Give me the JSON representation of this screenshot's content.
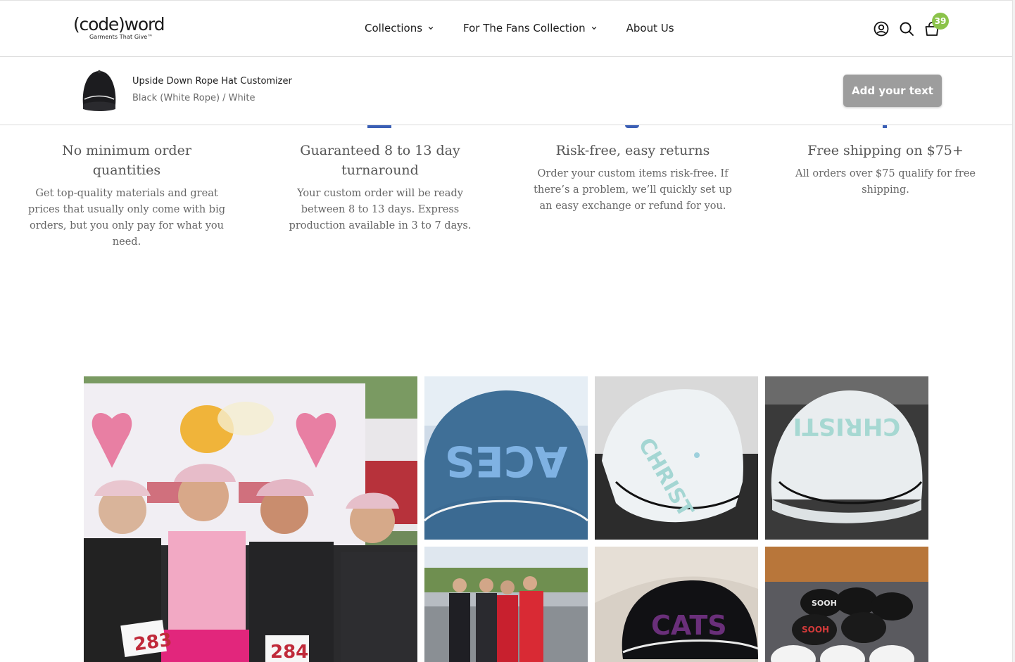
{
  "header": {
    "logo": {
      "main": "(code)word",
      "tagline": "Garments That Give™"
    },
    "nav": [
      {
        "label": "Collections",
        "has_dropdown": true
      },
      {
        "label": "For The Fans Collection",
        "has_dropdown": true
      },
      {
        "label": "About Us",
        "has_dropdown": false
      }
    ],
    "icons": [
      "account-icon",
      "search-icon",
      "cart-icon"
    ],
    "cart_count": "39",
    "badge_color": "#8bc34a"
  },
  "product_bar": {
    "title": "Upside Down Rope Hat Customizer",
    "variant": "Black (White Rope) / White",
    "cta_label": "Add your text",
    "cta_color": "#9d9d9d"
  },
  "features": [
    {
      "title": "No minimum order quantities",
      "body": "Get top-quality materials and great prices that usually only come with big orders, but you only pay for what you need."
    },
    {
      "title": "Guaranteed 8 to 13 day turnaround",
      "body": "Your custom order will be ready between 8 to 13 days. Express production available in 3 to 7 days."
    },
    {
      "title": "Risk-free, easy returns",
      "body": "Order your custom items risk-free. If there’s a problem, we’ll quickly set up an easy exchange or refund for you."
    },
    {
      "title": "Free shipping on $75+",
      "body": "All orders over $75 qualify for free shipping."
    }
  ],
  "gallery": {
    "tiles": [
      {
        "desc": "team-photo-pink-hats",
        "text": "283"
      },
      {
        "desc": "aces-hat-back",
        "text": "ACES"
      },
      {
        "desc": "white-hat-christ-left",
        "text": "CHRIST"
      },
      {
        "desc": "white-hat-christ-right",
        "text": "CHRISTI"
      },
      {
        "desc": "group-photo-outdoors",
        "text": ""
      },
      {
        "desc": "black-hat-cats",
        "text": "CATS"
      },
      {
        "desc": "hats-on-floor",
        "text": "SOOH"
      }
    ]
  }
}
